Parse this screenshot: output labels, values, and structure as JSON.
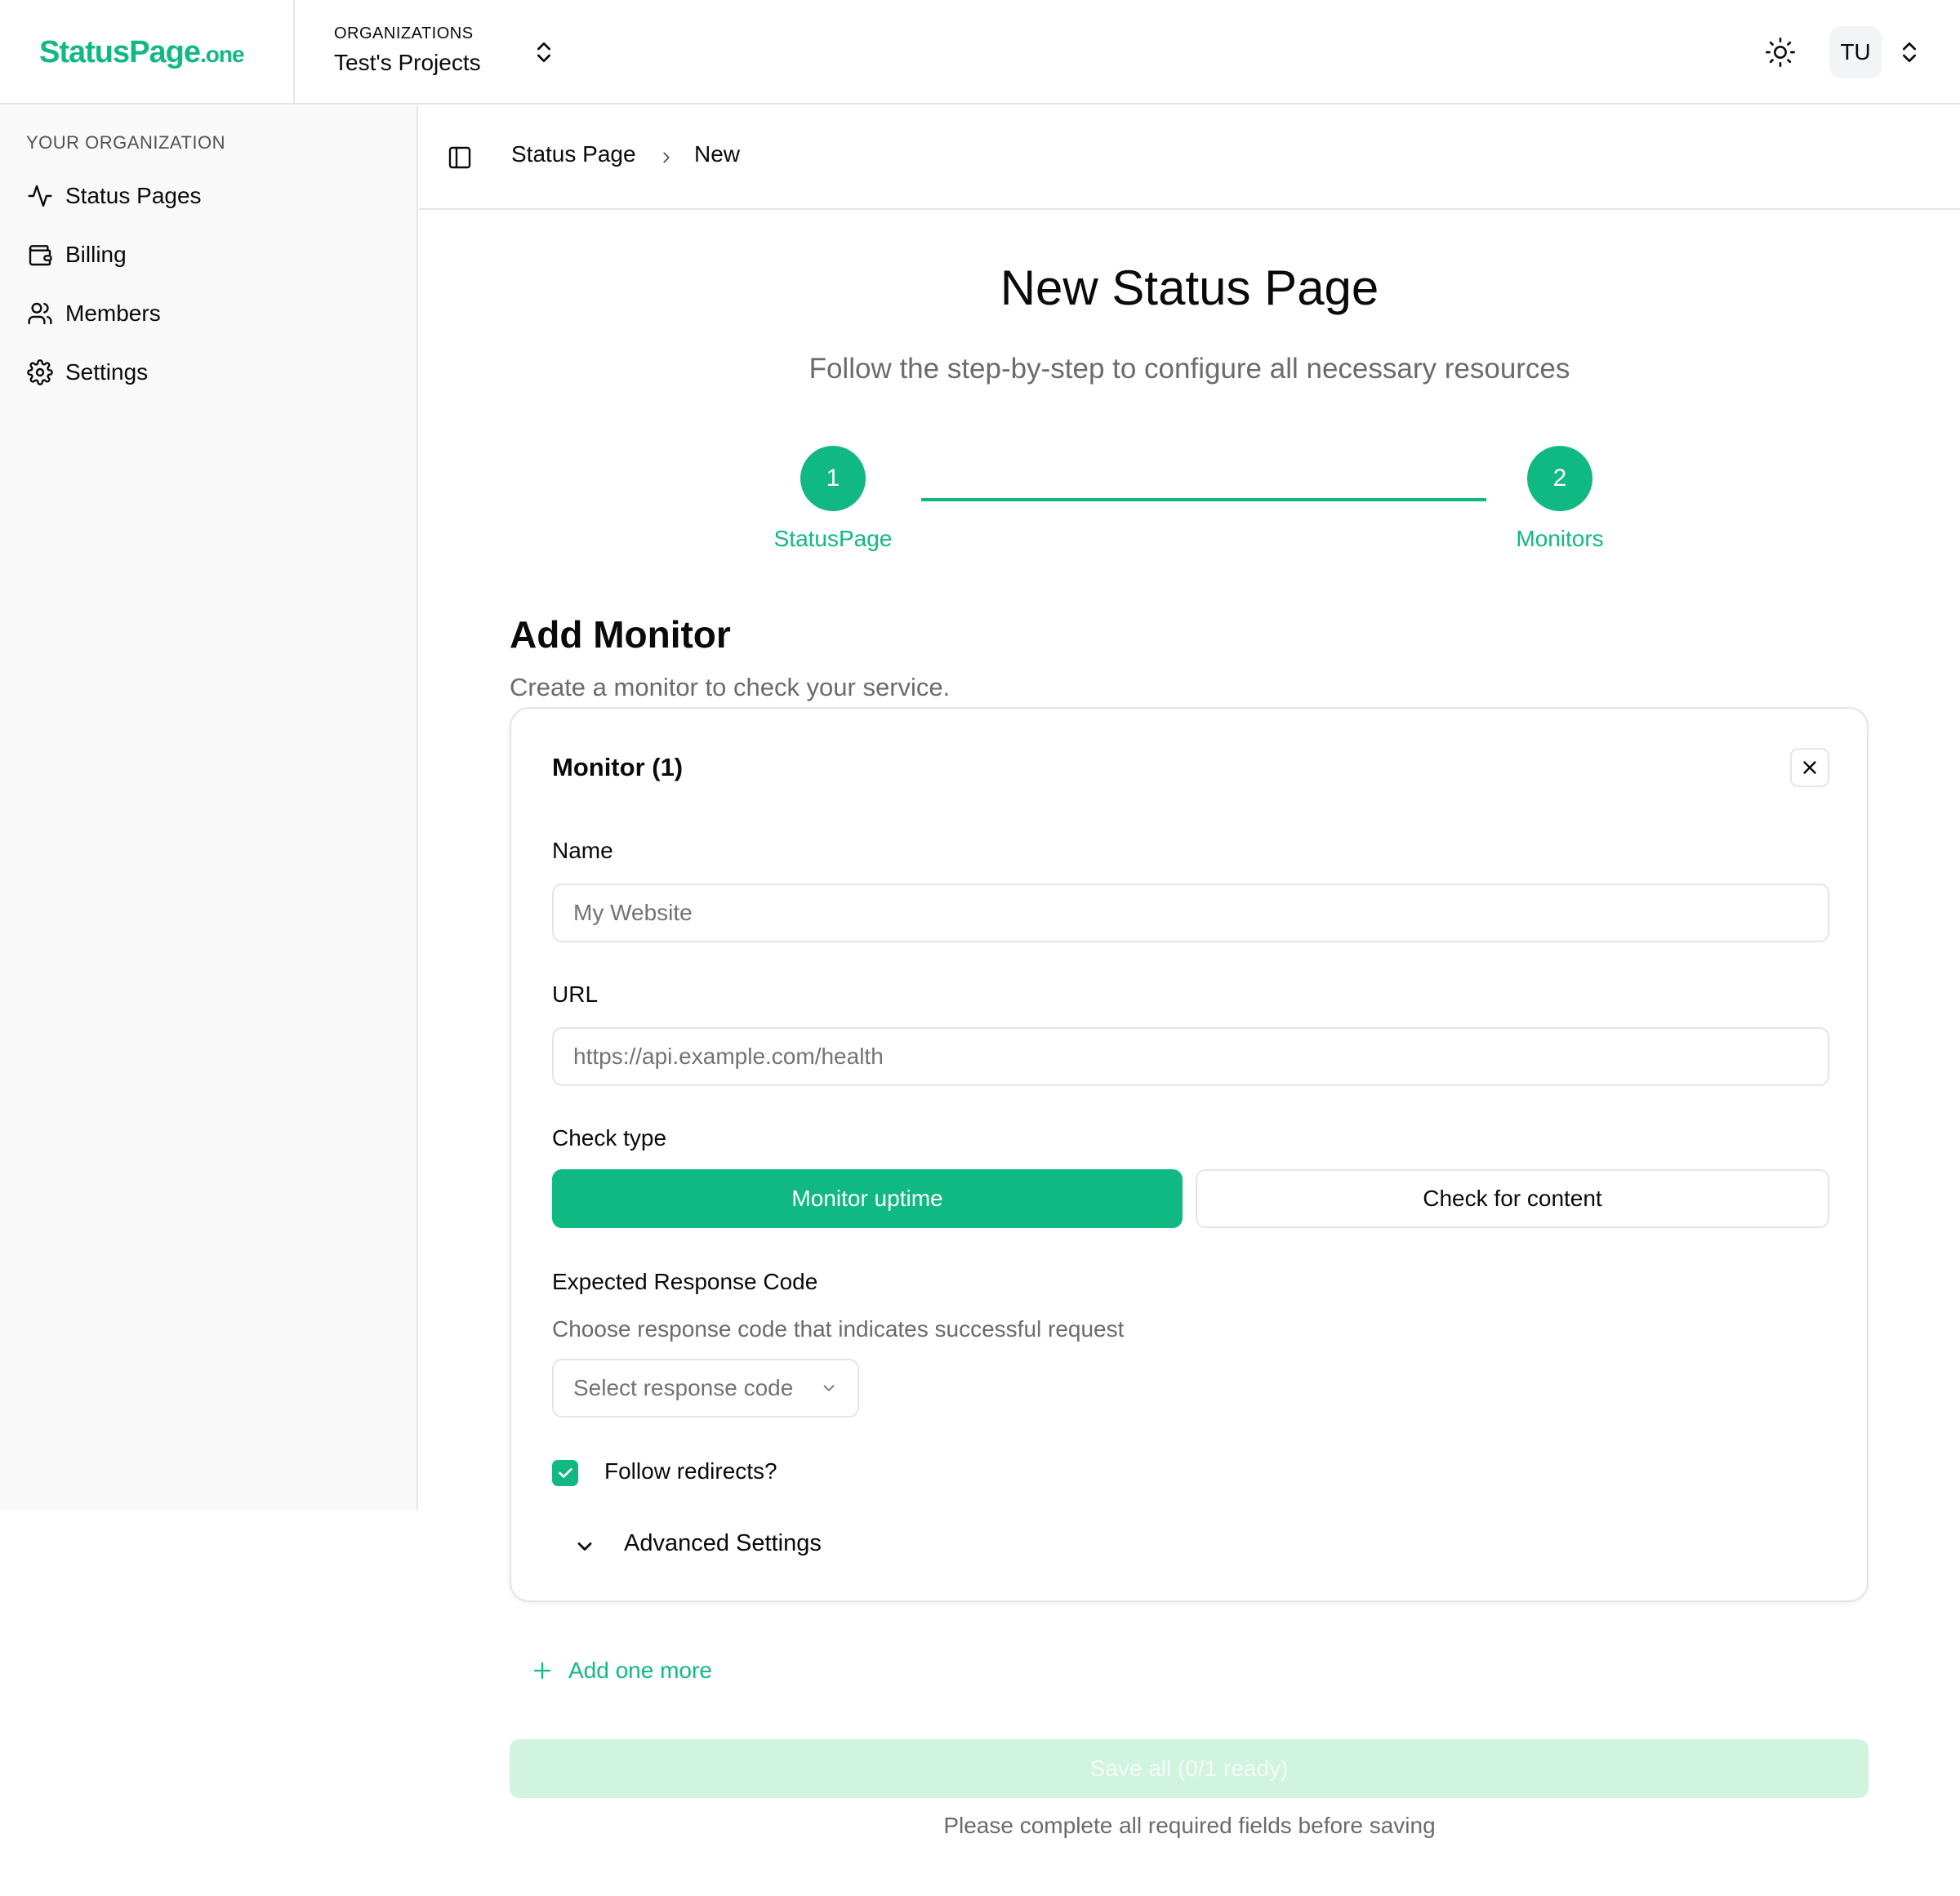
{
  "brand": {
    "logo_main": "StatusPage",
    "logo_suffix": ".one",
    "accent": "#10b981"
  },
  "header": {
    "org_label": "ORGANIZATIONS",
    "org_name": "Test's Projects",
    "avatar_initials": "TU",
    "theme_icon": "sun-icon"
  },
  "sidebar": {
    "heading": "YOUR ORGANIZATION",
    "items": [
      {
        "label": "Status Pages",
        "icon": "activity-icon"
      },
      {
        "label": "Billing",
        "icon": "wallet-icon"
      },
      {
        "label": "Members",
        "icon": "users-icon"
      },
      {
        "label": "Settings",
        "icon": "gear-icon"
      }
    ]
  },
  "breadcrumb": {
    "items": [
      "Status Page",
      "New"
    ]
  },
  "page": {
    "title": "New Status Page",
    "subtitle": "Follow the step-by-step to configure all necessary resources"
  },
  "stepper": {
    "steps": [
      {
        "number": "1",
        "label": "StatusPage"
      },
      {
        "number": "2",
        "label": "Monitors"
      }
    ]
  },
  "section": {
    "title": "Add Monitor",
    "description": "Create a monitor to check your service."
  },
  "monitor_card": {
    "title": "Monitor (1)",
    "name_label": "Name",
    "name_placeholder": "My Website",
    "name_value": "",
    "url_label": "URL",
    "url_placeholder": "https://api.example.com/health",
    "url_value": "",
    "check_type_label": "Check type",
    "check_type_options": [
      "Monitor uptime",
      "Check for content"
    ],
    "check_type_selected": "Monitor uptime",
    "response_code_label": "Expected Response Code",
    "response_code_help": "Choose response code that indicates successful request",
    "response_code_placeholder": "Select response code",
    "follow_redirects_label": "Follow redirects?",
    "follow_redirects_checked": true,
    "advanced_label": "Advanced Settings"
  },
  "actions": {
    "add_more_label": "Add one more",
    "save_label": "Save all (0/1 ready)",
    "save_note": "Please complete all required fields before saving"
  }
}
